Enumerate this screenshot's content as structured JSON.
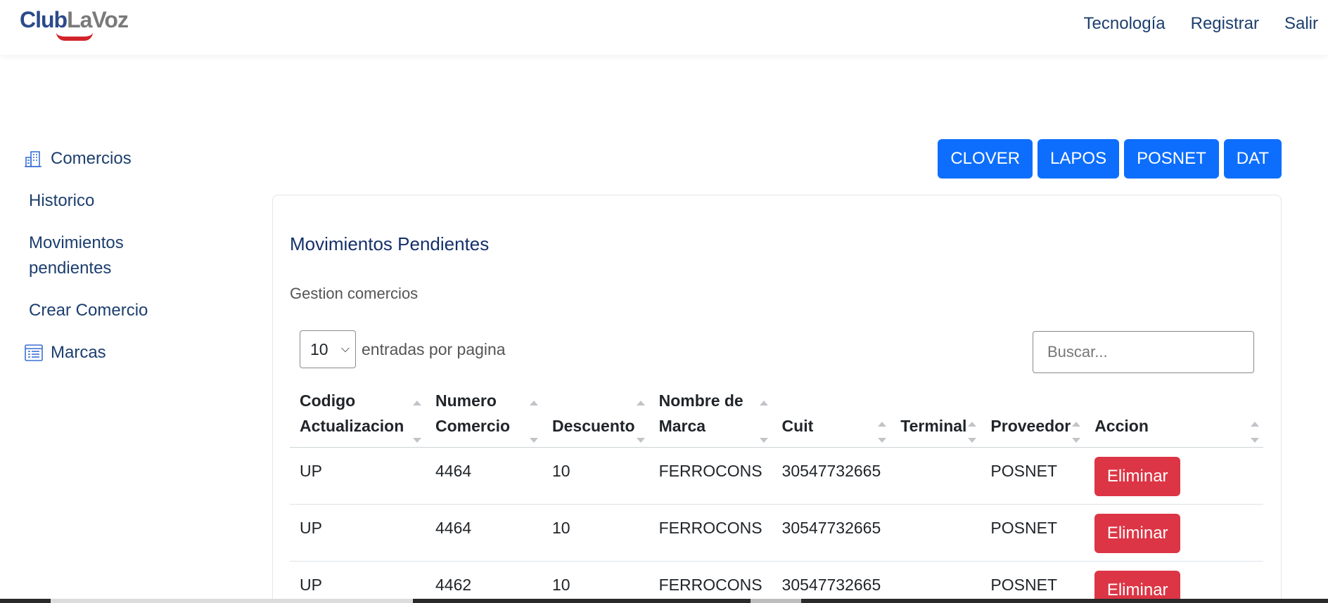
{
  "header": {
    "logo_part1": "Club",
    "logo_part2": "LaVoz",
    "nav": [
      "Tecnología",
      "Registrar",
      "Salir"
    ]
  },
  "sidebar": {
    "items": [
      {
        "label": "Comercios",
        "icon": "building-icon"
      },
      {
        "label": "Historico"
      },
      {
        "label": "Movimientos pendientes"
      },
      {
        "label": "Crear Comercio"
      },
      {
        "label": "Marcas",
        "icon": "table-list-icon"
      }
    ]
  },
  "provider_buttons": [
    "CLOVER",
    "LAPOS",
    "POSNET",
    "DAT"
  ],
  "card": {
    "title": "Movimientos Pendientes",
    "subtitle": "Gestion comercios",
    "page_length": "10",
    "page_length_label": "entradas por pagina",
    "search_placeholder": "Buscar..."
  },
  "table": {
    "columns": [
      "Codigo Actualizacion",
      "Numero Comercio",
      "Descuento",
      "Nombre de Marca",
      "Cuit",
      "Terminal",
      "Proveedor",
      "Accion"
    ],
    "rows": [
      [
        "UP",
        "4464",
        "10",
        "FERROCONS",
        "30547732665",
        "",
        "POSNET",
        "Eliminar"
      ],
      [
        "UP",
        "4464",
        "10",
        "FERROCONS",
        "30547732665",
        "",
        "POSNET",
        "Eliminar"
      ],
      [
        "UP",
        "4462",
        "10",
        "FERROCONS",
        "30547732665",
        "",
        "POSNET",
        "Eliminar"
      ]
    ]
  },
  "colors": {
    "primary": "#0d6efd",
    "danger": "#dc3545",
    "nav_text": "#1c3e6e",
    "logo_blue": "#2b4a8a",
    "logo_red": "#d2232a"
  }
}
